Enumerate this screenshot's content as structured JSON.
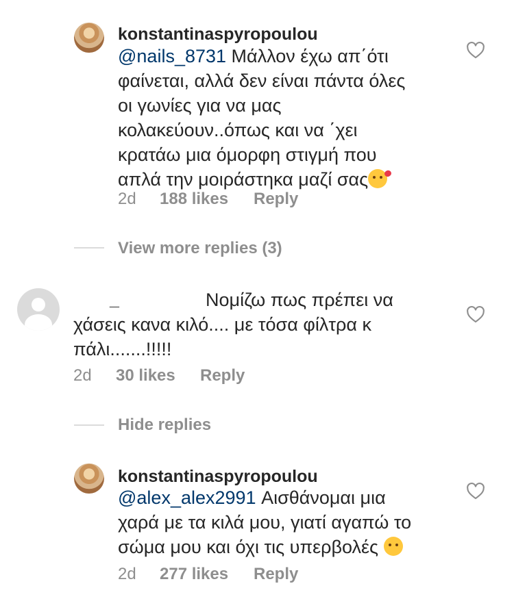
{
  "comments": [
    {
      "username": "konstantinaspyropoulou",
      "mention": "@nails_8731",
      "lines": [
        " Μάλλον έχω απ΄ότι",
        "φαίνεται, αλλά δεν είναι πάντα όλες",
        "οι γωνίες για να μας",
        "κολακεύουν..όπως και να ΄χει",
        "κρατάω μια όμορφη στιγμή που",
        "απλά την μοιράστηκα μαζί σας"
      ],
      "emoji": "kissing-face-with-heart",
      "time": "2d",
      "likes": "188 likes",
      "reply": "Reply"
    },
    {
      "username": "_",
      "lines": [
        "Νομίζω πως πρέπει να",
        "χάσεις κανα κιλό.... με τόσα φίλτρα κ",
        "πάλι.......!!!!!"
      ],
      "time": "2d",
      "likes": "30 likes",
      "reply": "Reply"
    },
    {
      "username": "konstantinaspyropoulou",
      "mention": "@alex_alex2991",
      "lines": [
        " Αισθάνομαι μια",
        "χαρά με τα κιλά μου, γιατί αγαπώ το",
        "σώμα μου και όχι τις υπερβολές "
      ],
      "emoji": "winking-face",
      "time": "2d",
      "likes": "277 likes",
      "reply": "Reply"
    }
  ],
  "view_more": "View more replies (3)",
  "hide_replies": "Hide replies"
}
